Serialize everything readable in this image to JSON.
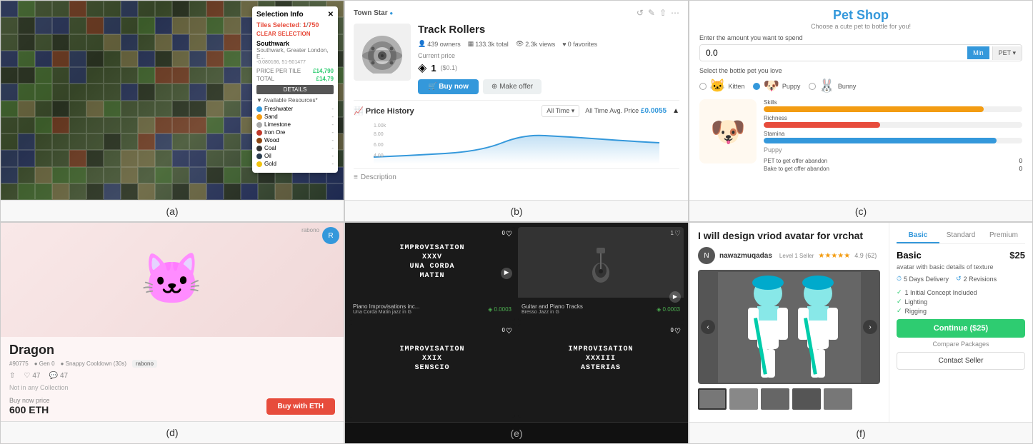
{
  "cells": {
    "a": {
      "label": "(a)",
      "panel": {
        "title": "Selection Info",
        "tiles_label": "Tiles Selected",
        "tiles_count": "1",
        "tiles_total": "750",
        "clear_btn": "CLEAR SELECTION",
        "location_name": "Southwark",
        "location_sub": "Southwark, Greater London, E...",
        "coords": "-0.080166, 51-501477",
        "price_per_tile_label": "PRICE PER TILE",
        "price_per_tile_val": "£14,790",
        "price_total_label": "TOTAL",
        "price_total_val": "£14,79",
        "details_btn": "DETAILS",
        "resources_title": "Available Resources*",
        "resources": [
          {
            "name": "Freshwater",
            "color": "#3498db"
          },
          {
            "name": "Sand",
            "color": "#f39c12"
          },
          {
            "name": "Limestone",
            "color": "#aaa"
          },
          {
            "name": "Iron Ore",
            "color": "#c0392b"
          },
          {
            "name": "Wood",
            "color": "#8B4513"
          },
          {
            "name": "Coal",
            "color": "#333"
          },
          {
            "name": "Oil",
            "color": "#2c3e50"
          },
          {
            "name": "Gold",
            "color": "#f1c40f"
          }
        ]
      }
    },
    "b": {
      "label": "(b)",
      "store_name": "Town Star",
      "verified": true,
      "product_title": "Track Rollers",
      "stats": {
        "owners": "439 owners",
        "total": "133.3k total",
        "views": "2.3k views",
        "favorites": "0 favorites"
      },
      "current_price_label": "Current price",
      "price_main": "1",
      "price_sub": "($0.1)",
      "buy_btn": "Buy now",
      "offer_btn": "Make offer",
      "price_history_title": "Price History",
      "time_options": [
        "All Time"
      ],
      "avg_price_label": "All Time Avg. Price",
      "avg_price_val": "£0.0055",
      "chart_y_labels": [
        "1.00k",
        "8.00",
        "6.00",
        "4.00"
      ],
      "description_label": "Description"
    },
    "c": {
      "label": "(c)",
      "title": "Pet Shop",
      "subtitle": "Choose a cute pet to bottle for you!",
      "amount_label": "Enter the amount you want to spend",
      "amount_value": "0.0",
      "amount_min": "Min",
      "amount_pet": "PET",
      "select_label": "Select the bottle pet you love",
      "pets": [
        {
          "name": "Kitten",
          "icon": "🐱"
        },
        {
          "name": "Puppy",
          "icon": "🐶"
        },
        {
          "name": "Bunny",
          "icon": "🐰"
        }
      ],
      "selected_pet": "Puppy",
      "stats": [
        {
          "label": "Skills",
          "fill": 85,
          "color": "#f39c12"
        },
        {
          "label": "Richness",
          "fill": 45,
          "color": "#e74c3c"
        },
        {
          "label": "Stamina",
          "fill": 90,
          "color": "#3498db"
        }
      ],
      "abandon_table": [
        {
          "label": "PET to get offer abandon",
          "val": "0"
        },
        {
          "label": "Bake to get offer abandon",
          "val": "0"
        }
      ]
    },
    "d": {
      "label": "(d)",
      "title": "Dragon",
      "tags": [
        "#90775",
        "Gen 0",
        "Snappy Cooldown (30s)"
      ],
      "badge": "rabono",
      "not_collection": "Not in any Collection",
      "actions": [
        "share",
        "47",
        "47"
      ],
      "price_label": "Buy now price",
      "price_val": "600 ETH",
      "buy_btn": "Buy with ETH"
    },
    "e": {
      "label": "(e)",
      "cards": [
        {
          "type": "text",
          "lines": [
            "IMPROVISATION",
            "XXXV",
            "UNA CORDA",
            "MATIN"
          ],
          "bg_color": "#111",
          "text_color": "#fff",
          "title": "Piano Improvisations inc...",
          "subtitle": "Una Corda Matin jazz in G",
          "price": "0.0003",
          "likes": "0",
          "hearts": "0"
        },
        {
          "type": "photo",
          "bg_color": "#555",
          "title": "Guitar and Piano Tracks",
          "subtitle": "Bresso Jazz in G",
          "price": "0.0003",
          "likes": "1",
          "hearts": "0"
        },
        {
          "type": "text",
          "lines": [
            "IMPROVISATION",
            "XXIX",
            "SENSCIO"
          ],
          "bg_color": "#111",
          "text_color": "#fff",
          "title": "",
          "subtitle": "",
          "price": "",
          "likes": "0",
          "hearts": "0"
        },
        {
          "type": "text",
          "lines": [
            "IMPROVISATION",
            "XXXIII",
            "ASTERIAS"
          ],
          "bg_color": "#111",
          "text_color": "#fff",
          "title": "",
          "subtitle": "",
          "price": "",
          "likes": "0",
          "hearts": "0"
        }
      ]
    },
    "f": {
      "label": "(f)",
      "title": "I will design vriod avatar for vrchat",
      "seller_name": "nawazmuqadas",
      "seller_level": "Level 1 Seller",
      "rating": "4.9",
      "reviews": "62",
      "tabs": [
        "Basic",
        "Standard",
        "Premium"
      ],
      "active_tab": "Basic",
      "plan_name": "Basic",
      "plan_price": "$25",
      "plan_desc": "avatar with basic details of texture",
      "delivery": "5 Days Delivery",
      "revisions": "2 Revisions",
      "features": [
        "1 Initial Concept Included",
        "Lighting",
        "Rigging"
      ],
      "continue_btn": "Continue ($25)",
      "compare_link": "Compare Packages",
      "contact_btn": "Contact Seller"
    }
  }
}
